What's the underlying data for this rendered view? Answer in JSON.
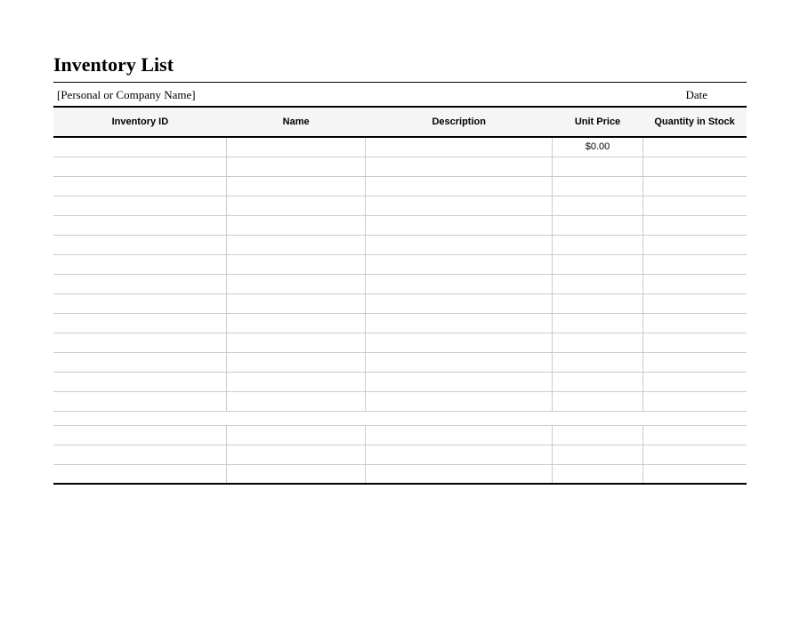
{
  "title": "Inventory List",
  "header": {
    "name_placeholder": "[Personal or Company Name]",
    "date_label": "Date"
  },
  "columns": {
    "col1": "Inventory ID",
    "col2": "Name",
    "col3": "Description",
    "col4": "Unit Price",
    "col5": "Quantity in Stock"
  },
  "rows": {
    "r0c3": "$0.00"
  }
}
